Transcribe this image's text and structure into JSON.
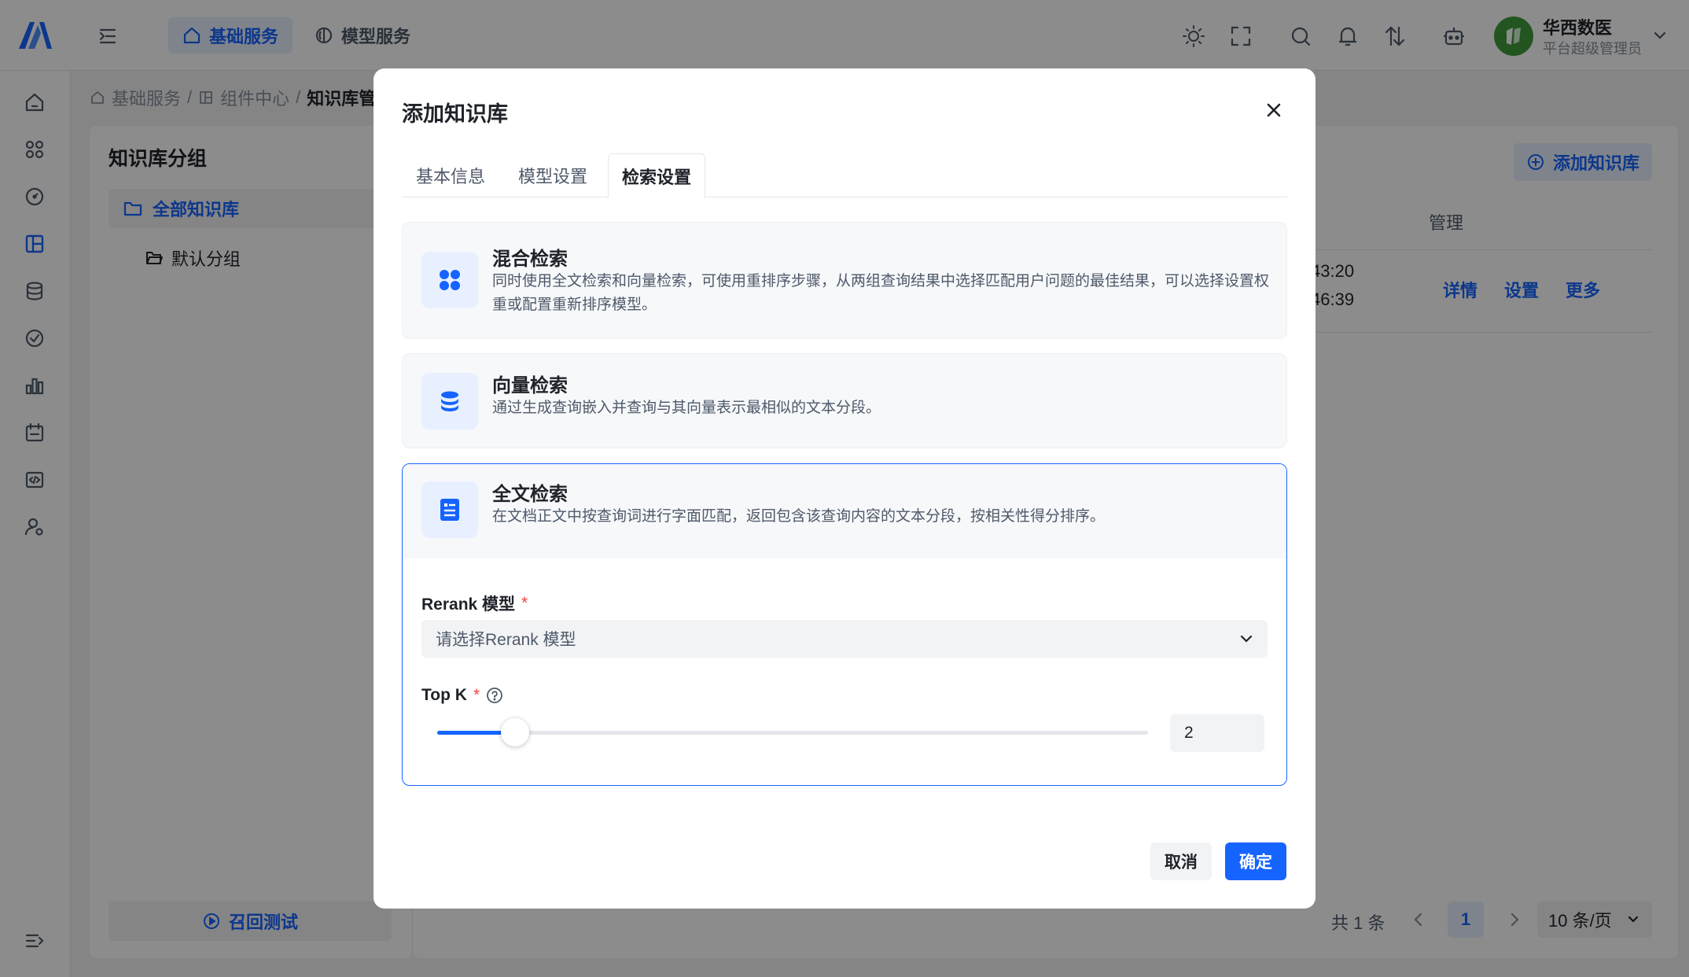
{
  "header": {
    "nav_tabs": [
      {
        "label": "基础服务",
        "active": true
      },
      {
        "label": "模型服务",
        "active": false
      }
    ],
    "user": {
      "name": "华西数医",
      "role": "平台超级管理员"
    }
  },
  "breadcrumb": {
    "items": [
      "基础服务",
      "组件中心",
      "知识库管理"
    ]
  },
  "group_panel": {
    "title": "知识库分组",
    "all_label": "全部知识库",
    "default_label": "默认分组",
    "recall_test_label": "召回测试"
  },
  "list_panel": {
    "add_button": "添加知识库",
    "column_manage": "管理",
    "row": {
      "time_fragment_1": "43:20",
      "time_fragment_2": "46:39",
      "actions": [
        "详情",
        "设置",
        "更多"
      ]
    },
    "pagination": {
      "total": "共 1 条",
      "current_page": "1",
      "page_size": "10 条/页"
    }
  },
  "modal": {
    "title": "添加知识库",
    "tabs": [
      "基本信息",
      "模型设置",
      "检索设置"
    ],
    "active_tab": "检索设置",
    "options": [
      {
        "title": "混合检索",
        "description": "同时使用全文检索和向量检索，可使用重排序步骤，从两组查询结果中选择匹配用户问题的最佳结果，可以选择设置权重或配置重新排序模型。",
        "icon": "grid-icon"
      },
      {
        "title": "向量检索",
        "description": "通过生成查询嵌入并查询与其向量表示最相似的文本分段。",
        "icon": "database-icon"
      },
      {
        "title": "全文检索",
        "description": "在文档正文中按查询词进行字面匹配，返回包含该查询内容的文本分段，按相关性得分排序。",
        "icon": "document-icon",
        "selected": true
      }
    ],
    "rerank": {
      "label": "Rerank 模型",
      "required_mark": "*",
      "placeholder": "请选择Rerank 模型"
    },
    "topk": {
      "label": "Top K",
      "required_mark": "*",
      "value": "2",
      "slider_fraction": 0.11
    },
    "cancel_label": "取消",
    "confirm_label": "确定"
  },
  "colors": {
    "primary": "#1664ff",
    "required": "#f53f3f",
    "avatar": "#3f9b3a"
  }
}
